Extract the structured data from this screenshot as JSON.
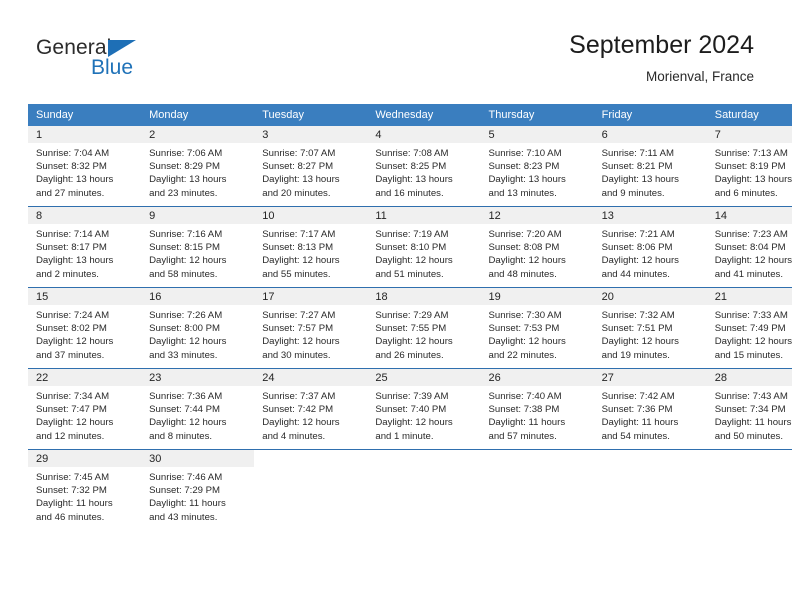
{
  "brand": {
    "word_one": "General",
    "word_two": "Blue",
    "triangle_icon": "triangle-icon",
    "accent_color": "#1f72b8"
  },
  "header": {
    "title": "September 2024",
    "subtitle": "Morienval, France"
  },
  "calendar": {
    "header_bg": "#3a7ebf",
    "daynum_bg": "#f0f0f0",
    "weekday_headers": [
      "Sunday",
      "Monday",
      "Tuesday",
      "Wednesday",
      "Thursday",
      "Friday",
      "Saturday"
    ],
    "weeks": [
      [
        {
          "day": "1",
          "sunrise": "Sunrise: 7:04 AM",
          "sunset": "Sunset: 8:32 PM",
          "daylight_1": "Daylight: 13 hours",
          "daylight_2": "and 27 minutes."
        },
        {
          "day": "2",
          "sunrise": "Sunrise: 7:06 AM",
          "sunset": "Sunset: 8:29 PM",
          "daylight_1": "Daylight: 13 hours",
          "daylight_2": "and 23 minutes."
        },
        {
          "day": "3",
          "sunrise": "Sunrise: 7:07 AM",
          "sunset": "Sunset: 8:27 PM",
          "daylight_1": "Daylight: 13 hours",
          "daylight_2": "and 20 minutes."
        },
        {
          "day": "4",
          "sunrise": "Sunrise: 7:08 AM",
          "sunset": "Sunset: 8:25 PM",
          "daylight_1": "Daylight: 13 hours",
          "daylight_2": "and 16 minutes."
        },
        {
          "day": "5",
          "sunrise": "Sunrise: 7:10 AM",
          "sunset": "Sunset: 8:23 PM",
          "daylight_1": "Daylight: 13 hours",
          "daylight_2": "and 13 minutes."
        },
        {
          "day": "6",
          "sunrise": "Sunrise: 7:11 AM",
          "sunset": "Sunset: 8:21 PM",
          "daylight_1": "Daylight: 13 hours",
          "daylight_2": "and 9 minutes."
        },
        {
          "day": "7",
          "sunrise": "Sunrise: 7:13 AM",
          "sunset": "Sunset: 8:19 PM",
          "daylight_1": "Daylight: 13 hours",
          "daylight_2": "and 6 minutes."
        }
      ],
      [
        {
          "day": "8",
          "sunrise": "Sunrise: 7:14 AM",
          "sunset": "Sunset: 8:17 PM",
          "daylight_1": "Daylight: 13 hours",
          "daylight_2": "and 2 minutes."
        },
        {
          "day": "9",
          "sunrise": "Sunrise: 7:16 AM",
          "sunset": "Sunset: 8:15 PM",
          "daylight_1": "Daylight: 12 hours",
          "daylight_2": "and 58 minutes."
        },
        {
          "day": "10",
          "sunrise": "Sunrise: 7:17 AM",
          "sunset": "Sunset: 8:13 PM",
          "daylight_1": "Daylight: 12 hours",
          "daylight_2": "and 55 minutes."
        },
        {
          "day": "11",
          "sunrise": "Sunrise: 7:19 AM",
          "sunset": "Sunset: 8:10 PM",
          "daylight_1": "Daylight: 12 hours",
          "daylight_2": "and 51 minutes."
        },
        {
          "day": "12",
          "sunrise": "Sunrise: 7:20 AM",
          "sunset": "Sunset: 8:08 PM",
          "daylight_1": "Daylight: 12 hours",
          "daylight_2": "and 48 minutes."
        },
        {
          "day": "13",
          "sunrise": "Sunrise: 7:21 AM",
          "sunset": "Sunset: 8:06 PM",
          "daylight_1": "Daylight: 12 hours",
          "daylight_2": "and 44 minutes."
        },
        {
          "day": "14",
          "sunrise": "Sunrise: 7:23 AM",
          "sunset": "Sunset: 8:04 PM",
          "daylight_1": "Daylight: 12 hours",
          "daylight_2": "and 41 minutes."
        }
      ],
      [
        {
          "day": "15",
          "sunrise": "Sunrise: 7:24 AM",
          "sunset": "Sunset: 8:02 PM",
          "daylight_1": "Daylight: 12 hours",
          "daylight_2": "and 37 minutes."
        },
        {
          "day": "16",
          "sunrise": "Sunrise: 7:26 AM",
          "sunset": "Sunset: 8:00 PM",
          "daylight_1": "Daylight: 12 hours",
          "daylight_2": "and 33 minutes."
        },
        {
          "day": "17",
          "sunrise": "Sunrise: 7:27 AM",
          "sunset": "Sunset: 7:57 PM",
          "daylight_1": "Daylight: 12 hours",
          "daylight_2": "and 30 minutes."
        },
        {
          "day": "18",
          "sunrise": "Sunrise: 7:29 AM",
          "sunset": "Sunset: 7:55 PM",
          "daylight_1": "Daylight: 12 hours",
          "daylight_2": "and 26 minutes."
        },
        {
          "day": "19",
          "sunrise": "Sunrise: 7:30 AM",
          "sunset": "Sunset: 7:53 PM",
          "daylight_1": "Daylight: 12 hours",
          "daylight_2": "and 22 minutes."
        },
        {
          "day": "20",
          "sunrise": "Sunrise: 7:32 AM",
          "sunset": "Sunset: 7:51 PM",
          "daylight_1": "Daylight: 12 hours",
          "daylight_2": "and 19 minutes."
        },
        {
          "day": "21",
          "sunrise": "Sunrise: 7:33 AM",
          "sunset": "Sunset: 7:49 PM",
          "daylight_1": "Daylight: 12 hours",
          "daylight_2": "and 15 minutes."
        }
      ],
      [
        {
          "day": "22",
          "sunrise": "Sunrise: 7:34 AM",
          "sunset": "Sunset: 7:47 PM",
          "daylight_1": "Daylight: 12 hours",
          "daylight_2": "and 12 minutes."
        },
        {
          "day": "23",
          "sunrise": "Sunrise: 7:36 AM",
          "sunset": "Sunset: 7:44 PM",
          "daylight_1": "Daylight: 12 hours",
          "daylight_2": "and 8 minutes."
        },
        {
          "day": "24",
          "sunrise": "Sunrise: 7:37 AM",
          "sunset": "Sunset: 7:42 PM",
          "daylight_1": "Daylight: 12 hours",
          "daylight_2": "and 4 minutes."
        },
        {
          "day": "25",
          "sunrise": "Sunrise: 7:39 AM",
          "sunset": "Sunset: 7:40 PM",
          "daylight_1": "Daylight: 12 hours",
          "daylight_2": "and 1 minute."
        },
        {
          "day": "26",
          "sunrise": "Sunrise: 7:40 AM",
          "sunset": "Sunset: 7:38 PM",
          "daylight_1": "Daylight: 11 hours",
          "daylight_2": "and 57 minutes."
        },
        {
          "day": "27",
          "sunrise": "Sunrise: 7:42 AM",
          "sunset": "Sunset: 7:36 PM",
          "daylight_1": "Daylight: 11 hours",
          "daylight_2": "and 54 minutes."
        },
        {
          "day": "28",
          "sunrise": "Sunrise: 7:43 AM",
          "sunset": "Sunset: 7:34 PM",
          "daylight_1": "Daylight: 11 hours",
          "daylight_2": "and 50 minutes."
        }
      ],
      [
        {
          "day": "29",
          "sunrise": "Sunrise: 7:45 AM",
          "sunset": "Sunset: 7:32 PM",
          "daylight_1": "Daylight: 11 hours",
          "daylight_2": "and 46 minutes."
        },
        {
          "day": "30",
          "sunrise": "Sunrise: 7:46 AM",
          "sunset": "Sunset: 7:29 PM",
          "daylight_1": "Daylight: 11 hours",
          "daylight_2": "and 43 minutes."
        },
        {
          "day": "",
          "sunrise": "",
          "sunset": "",
          "daylight_1": "",
          "daylight_2": ""
        },
        {
          "day": "",
          "sunrise": "",
          "sunset": "",
          "daylight_1": "",
          "daylight_2": ""
        },
        {
          "day": "",
          "sunrise": "",
          "sunset": "",
          "daylight_1": "",
          "daylight_2": ""
        },
        {
          "day": "",
          "sunrise": "",
          "sunset": "",
          "daylight_1": "",
          "daylight_2": ""
        },
        {
          "day": "",
          "sunrise": "",
          "sunset": "",
          "daylight_1": "",
          "daylight_2": ""
        }
      ]
    ]
  }
}
